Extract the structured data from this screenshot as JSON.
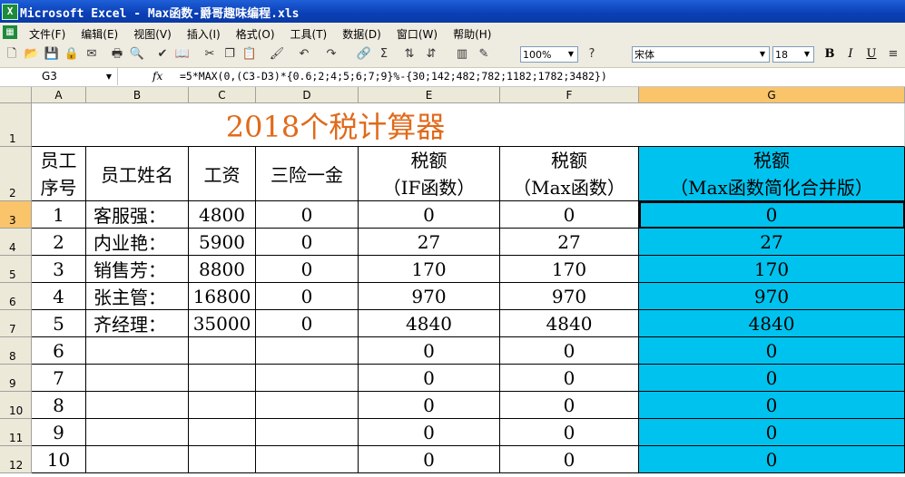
{
  "window": {
    "title": "Microsoft Excel - Max函数-爵哥趣味编程.xls",
    "app_icon_glyph": "X"
  },
  "menu": {
    "items": [
      "文件(F)",
      "编辑(E)",
      "视图(V)",
      "插入(I)",
      "格式(O)",
      "工具(T)",
      "数据(D)",
      "窗口(W)",
      "帮助(H)"
    ]
  },
  "toolbar": {
    "zoom": "100%",
    "font_name": "宋体",
    "font_size": "18",
    "bold": "B",
    "italic": "I",
    "underline": "U"
  },
  "formula_bar": {
    "cell_ref": "G3",
    "fx": "fx",
    "formula": "=5*MAX(0,(C3-D3)*{0.6;2;4;5;6;7;9}%-{30;142;482;782;1182;1782;3482})"
  },
  "columns": [
    "A",
    "B",
    "C",
    "D",
    "E",
    "F",
    "G"
  ],
  "rows": [
    "1",
    "2",
    "3",
    "4",
    "5",
    "6",
    "7",
    "8",
    "9",
    "10",
    "11",
    "12"
  ],
  "sheet": {
    "title": "2018个税计算器",
    "headers": {
      "a": [
        "员工",
        "序号"
      ],
      "b": "员工姓名",
      "c": "工资",
      "d": "三险一金",
      "e": [
        "税额",
        "（IF函数）"
      ],
      "f": [
        "税额",
        "（Max函数）"
      ],
      "g": [
        "税额",
        "（Max函数简化合并版）"
      ]
    },
    "data": [
      {
        "no": "1",
        "name": "客服强：",
        "salary": "4800",
        "insurance": "0",
        "tax_if": "0",
        "tax_max": "0",
        "tax_simple": "0"
      },
      {
        "no": "2",
        "name": "内业艳：",
        "salary": "5900",
        "insurance": "0",
        "tax_if": "27",
        "tax_max": "27",
        "tax_simple": "27"
      },
      {
        "no": "3",
        "name": "销售芳：",
        "salary": "8800",
        "insurance": "0",
        "tax_if": "170",
        "tax_max": "170",
        "tax_simple": "170"
      },
      {
        "no": "4",
        "name": "张主管：",
        "salary": "16800",
        "insurance": "0",
        "tax_if": "970",
        "tax_max": "970",
        "tax_simple": "970"
      },
      {
        "no": "5",
        "name": "齐经理：",
        "salary": "35000",
        "insurance": "0",
        "tax_if": "4840",
        "tax_max": "4840",
        "tax_simple": "4840"
      },
      {
        "no": "6",
        "name": "",
        "salary": "",
        "insurance": "",
        "tax_if": "0",
        "tax_max": "0",
        "tax_simple": "0"
      },
      {
        "no": "7",
        "name": "",
        "salary": "",
        "insurance": "",
        "tax_if": "0",
        "tax_max": "0",
        "tax_simple": "0"
      },
      {
        "no": "8",
        "name": "",
        "salary": "",
        "insurance": "",
        "tax_if": "0",
        "tax_max": "0",
        "tax_simple": "0"
      },
      {
        "no": "9",
        "name": "",
        "salary": "",
        "insurance": "",
        "tax_if": "0",
        "tax_max": "0",
        "tax_simple": "0"
      },
      {
        "no": "10",
        "name": "",
        "salary": "",
        "insurance": "",
        "tax_if": "0",
        "tax_max": "0",
        "tax_simple": "0"
      }
    ]
  },
  "colors": {
    "highlight": "#00c2ee",
    "title": "#e06a1b",
    "selected_header": "#f9c46a"
  }
}
